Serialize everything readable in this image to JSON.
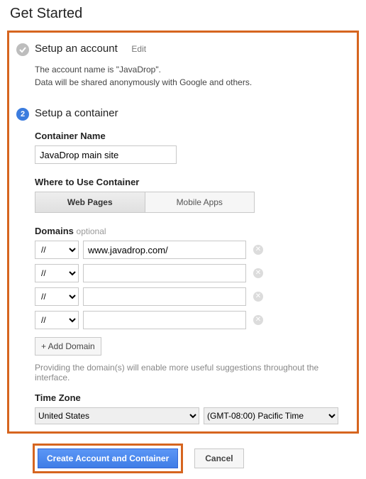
{
  "page_title": "Get Started",
  "step1": {
    "title": "Setup an account",
    "edit": "Edit",
    "summary_line1": "The account name is \"JavaDrop\".",
    "summary_line2": "Data will be shared anonymously with Google and others."
  },
  "step2": {
    "number": "2",
    "title": "Setup a container",
    "container_name_label": "Container Name",
    "container_name_value": "JavaDrop main site",
    "where_label": "Where to Use Container",
    "where_options": [
      "Web Pages",
      "Mobile Apps"
    ],
    "where_selected": 0,
    "domains_label": "Domains",
    "domains_optional": "optional",
    "protocol_option": "//",
    "domains": [
      {
        "value": "www.javadrop.com/"
      },
      {
        "value": ""
      },
      {
        "value": ""
      },
      {
        "value": ""
      }
    ],
    "add_domain": "+ Add Domain",
    "domain_hint": "Providing the domain(s) will enable more useful suggestions throughout the interface.",
    "tz_label": "Time Zone",
    "tz_country": "United States",
    "tz_zone": "(GMT-08:00) Pacific Time"
  },
  "actions": {
    "primary": "Create Account and Container",
    "cancel": "Cancel"
  }
}
